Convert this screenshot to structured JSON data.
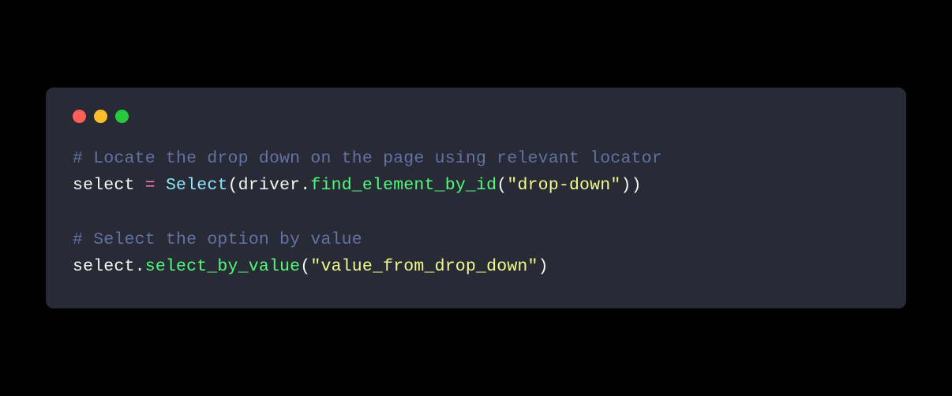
{
  "colors": {
    "background": "#000000",
    "window_bg": "#282a36",
    "dot_red": "#ff5f56",
    "dot_yellow": "#ffbd2e",
    "dot_green": "#27c93f",
    "comment": "#6272a4",
    "plain": "#f8f8f2",
    "operator": "#ff79c6",
    "class": "#8be9fd",
    "method": "#50fa7b",
    "string": "#f1fa8c"
  },
  "titlebar": {
    "dot1": "close",
    "dot2": "minimize",
    "dot3": "zoom"
  },
  "code": {
    "line1": {
      "comment": "# Locate the drop down on the page using relevant locator"
    },
    "line2": {
      "p1": "select ",
      "op1": "=",
      "p2": " ",
      "cls": "Select",
      "p3": "(driver.",
      "m1": "find_element_by_id",
      "p4": "(",
      "s1": "\"drop-down\"",
      "p5": "))"
    },
    "line4": {
      "comment": "# Select the option by value"
    },
    "line5": {
      "p1": "select.",
      "m1": "select_by_value",
      "p2": "(",
      "s1": "\"value_from_drop_down\"",
      "p3": ")"
    }
  }
}
